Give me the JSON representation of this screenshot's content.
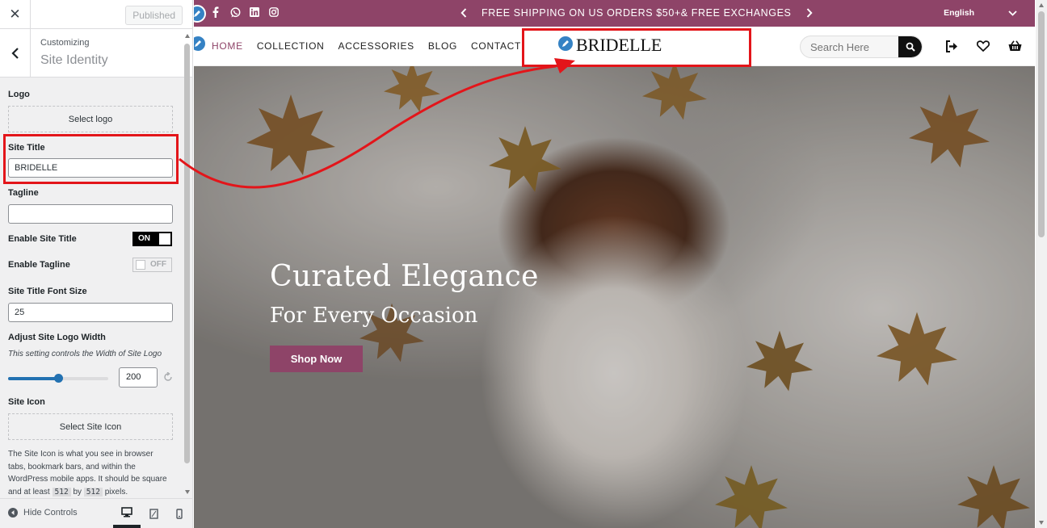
{
  "customizer": {
    "close_icon": "close-icon",
    "published_label": "Published",
    "section_breadcrumb": "Customizing",
    "section_title": "Site Identity",
    "logo_label": "Logo",
    "select_logo_label": "Select logo",
    "site_title_label": "Site Title",
    "site_title_value": "BRIDELLE",
    "tagline_label": "Tagline",
    "tagline_value": "",
    "enable_site_title_label": "Enable Site Title",
    "enable_site_title_state": "ON",
    "enable_tagline_label": "Enable Tagline",
    "enable_tagline_state": "OFF",
    "font_size_label": "Site Title Font Size",
    "font_size_value": "25",
    "logo_width_label": "Adjust Site Logo Width",
    "logo_width_desc": "This setting controls the Width of Site Logo",
    "logo_width_value": "200",
    "logo_width_slider_fraction": 0.5,
    "site_icon_label": "Site Icon",
    "select_site_icon_label": "Select Site Icon",
    "site_icon_help_1": "The Site Icon is what you see in browser tabs, bookmark bars, and within the WordPress mobile apps. It should be square and at least",
    "site_icon_help_code_1": "512",
    "site_icon_help_by": "by",
    "site_icon_help_code_2": "512",
    "site_icon_help_end": "pixels.",
    "hide_controls_label": "Hide Controls",
    "devices": [
      "desktop-icon",
      "tablet-icon",
      "mobile-icon"
    ]
  },
  "site": {
    "promo_text": "FREE SHIPPING ON US ORDERS $50+& FREE EXCHANGES",
    "language": "English",
    "social_icons": [
      "facebook-icon",
      "whatsapp-icon",
      "linkedin-icon",
      "instagram-icon"
    ],
    "nav": [
      "HOME",
      "COLLECTION",
      "ACCESSORIES",
      "BLOG",
      "CONTACT"
    ],
    "logo_text": "BRIDELLE",
    "search_placeholder": "Search Here",
    "hero_title": "Curated Elegance",
    "hero_subtitle": "For Every Occasion",
    "cta_label": "Shop Now"
  },
  "colors": {
    "brand": "#8e4468",
    "wp_blue": "#2271b1",
    "annotation_red": "#e3151a"
  }
}
